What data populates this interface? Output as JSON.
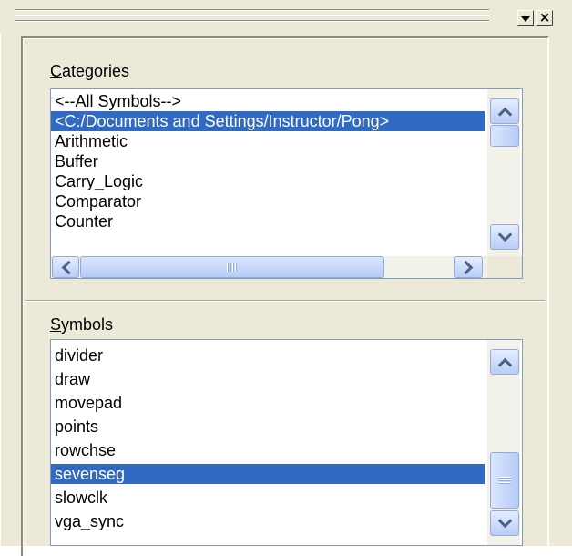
{
  "panel": {
    "toolbar": {
      "dropdown_icon": "dropdown-arrow-icon",
      "close_icon": "close-icon",
      "close_glyph": "×"
    }
  },
  "categories": {
    "label_mnemonic": "C",
    "label_rest": "ategories",
    "items": [
      "<--All Symbols-->",
      "<C:/Documents and Settings/Instructor/Pong>",
      "Arithmetic",
      "Buffer",
      "Carry_Logic",
      "Comparator",
      "Counter"
    ],
    "selected_index": 1,
    "vertical_scroll_fraction": 0.05,
    "horizontal_scroll_fraction": 0.0
  },
  "symbols": {
    "label_mnemonic": "S",
    "label_rest": "ymbols",
    "items": [
      "divider",
      "draw",
      "movepad",
      "points",
      "rowchse",
      "sevenseg",
      "slowclk",
      "vga_sync"
    ],
    "selected_index": 5,
    "vertical_scroll_fraction": 1.0
  },
  "colors": {
    "selection": "#316ac5",
    "panel_bg": "#ece9d8",
    "scrollbar_button": "#c1d3fb"
  }
}
